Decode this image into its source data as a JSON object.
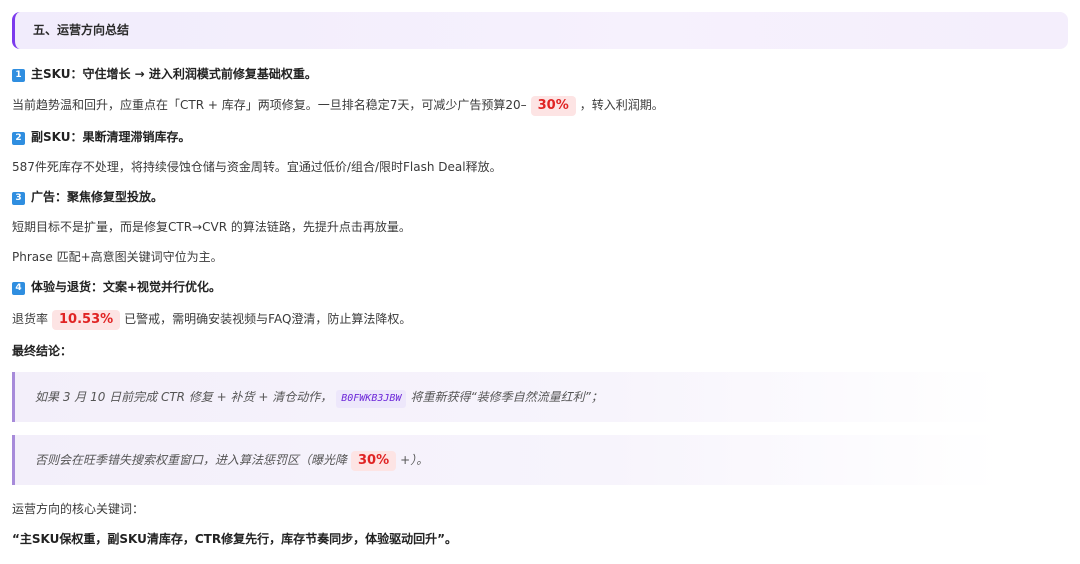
{
  "section": {
    "title": "五、运营方向总结"
  },
  "items": [
    {
      "number": "1",
      "heading": "主SKU：守住增长 → 进入利润模式前修复基础权重。",
      "body_before": "当前趋势温和回升，应重点在「CTR + 库存」两项修复。一旦排名稳定7天，可减少广告预算20–",
      "highlight": "30%",
      "body_after": "，转入利润期。"
    },
    {
      "number": "2",
      "heading": "副SKU：果断清理滞销库存。",
      "body": "587件死库存不处理，将持续侵蚀仓储与资金周转。宜通过低价/组合/限时Flash Deal释放。"
    },
    {
      "number": "3",
      "heading": "广告：聚焦修复型投放。",
      "body": "短期目标不是扩量，而是修复CTR→CVR 的算法链路，先提升点击再放量。",
      "body2": "Phrase 匹配+高意图关键词守位为主。"
    },
    {
      "number": "4",
      "heading": "体验与退货：文案+视觉并行优化。",
      "body_before": "退货率",
      "highlight": "10.53%",
      "body_after": "已警戒，需明确安装视频与FAQ澄清，防止算法降权。"
    }
  ],
  "conclusion": {
    "label": "最终结论：",
    "quote1_before": "如果 3 月 10 日前完成 CTR 修复 + 补货 + 清仓动作，",
    "quote1_code": "B0FWKB3JBW",
    "quote1_after": "将重新获得“装修季自然流量红利”；",
    "quote2_before": "否则会在旺季错失搜索权重窗口，进入算法惩罚区（曝光降",
    "quote2_highlight": "30%",
    "quote2_after": "+）。"
  },
  "keywords": {
    "label": "运营方向的核心关键词：",
    "text": "“主SKU保权重，副SKU清库存，CTR修复先行，库存节奏同步，体验驱动回升”。"
  },
  "colors": {
    "accent": "#7c3aed",
    "badge": "#2f8ee0",
    "highlight_text": "#e02424",
    "highlight_bg": "#fde4e4"
  }
}
